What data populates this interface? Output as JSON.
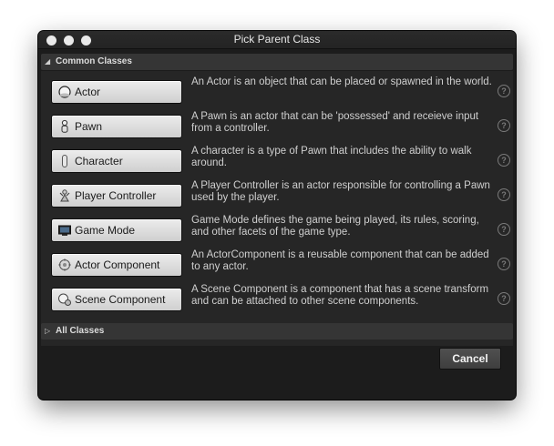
{
  "window": {
    "title": "Pick Parent Class"
  },
  "common_section": {
    "label": "Common Classes",
    "expanded": true
  },
  "all_section": {
    "label": "All Classes",
    "expanded": false
  },
  "classes": [
    {
      "name": "Actor",
      "icon": "actor-sphere-icon",
      "description": "An Actor is an object that can be placed or spawned in the world."
    },
    {
      "name": "Pawn",
      "icon": "pawn-figure-icon",
      "description": "A Pawn is an actor that can be 'possessed' and receieve input from a controller."
    },
    {
      "name": "Character",
      "icon": "character-capsule-icon",
      "description": "A character is a type of Pawn that includes the ability to walk around."
    },
    {
      "name": "Player Controller",
      "icon": "player-controller-icon",
      "description": "A Player Controller is an actor responsible for controlling a Pawn used by the player."
    },
    {
      "name": "Game Mode",
      "icon": "game-mode-monitor-icon",
      "description": "Game Mode defines the game being played, its rules, scoring, and other facets of the game type."
    },
    {
      "name": "Actor Component",
      "icon": "actor-component-icon",
      "description": "An ActorComponent is a reusable component that can be added to any actor."
    },
    {
      "name": "Scene Component",
      "icon": "scene-component-icon",
      "description": "A Scene Component is a component that has a scene transform and can be attached to other scene components."
    }
  ],
  "buttons": {
    "cancel": "Cancel"
  },
  "colors": {
    "window_bg": "#1c1c1c",
    "panel_bg": "#262626",
    "header_bg": "#353535",
    "button_light": "#e0e0e0"
  }
}
